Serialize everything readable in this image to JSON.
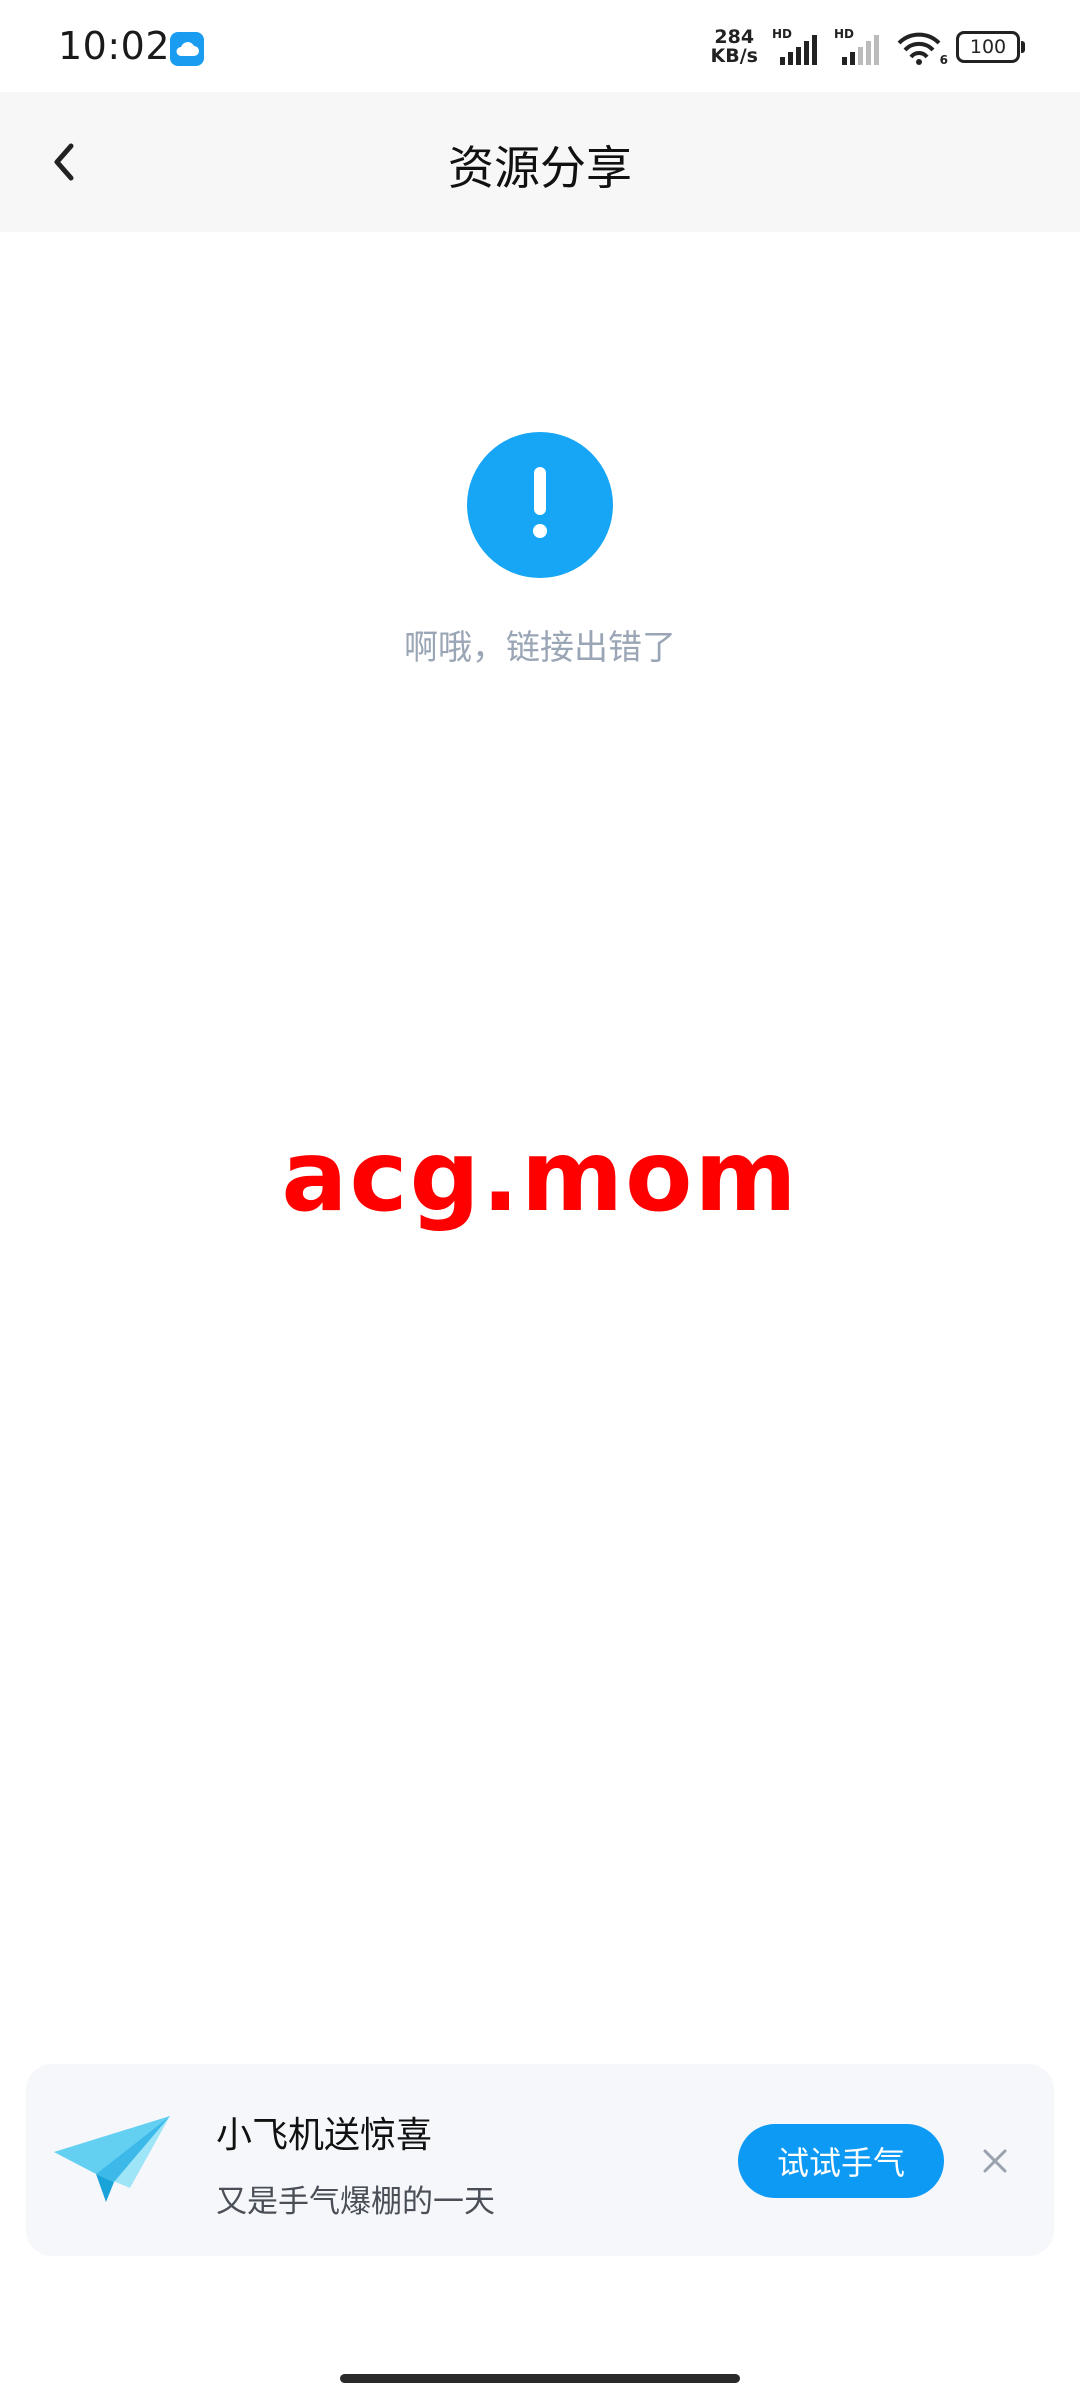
{
  "status_bar": {
    "time": "10:02",
    "network_speed_value": "284",
    "network_speed_unit": "KB/s",
    "signal1_label": "HD",
    "signal2_label": "HD",
    "wifi_label": "6",
    "battery": "100",
    "app_icon": "cloud-icon"
  },
  "header": {
    "title": "资源分享",
    "back_icon": "chevron-left-icon"
  },
  "error": {
    "icon": "exclamation-icon",
    "message": "啊哦，链接出错了",
    "color": "#16a6f5"
  },
  "watermark": {
    "text": "acg.mom",
    "color": "#ff0000"
  },
  "promo": {
    "icon": "paper-plane-icon",
    "title": "小飞机送惊喜",
    "subtitle": "又是手气爆棚的一天",
    "button_label": "试试手气",
    "close_icon": "close-icon",
    "button_color": "#0d9af5"
  }
}
